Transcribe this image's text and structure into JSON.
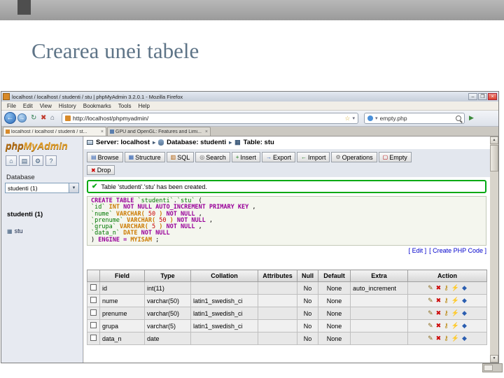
{
  "slide": {
    "title": "Crearea unei tabele"
  },
  "browser": {
    "window_title": "localhost / localhost / studenti / stu | phpMyAdmin 3.2.0.1 - Mozilla Firefox",
    "menu": [
      "File",
      "Edit",
      "View",
      "History",
      "Bookmarks",
      "Tools",
      "Help"
    ],
    "url": "http://localhost/phpmyadmin/",
    "search_value": "empty.php",
    "window_buttons": {
      "minimize": "–",
      "maximize": "❒",
      "close": "×"
    },
    "tabs": [
      {
        "label": "localhost / localhost / studenti / st...",
        "favicon_color": "#d88a2a"
      },
      {
        "label": "GPU and OpenGL: Features and Limi...",
        "favicon_color": "#5b7fae"
      }
    ]
  },
  "pma": {
    "logo_php": "php",
    "logo_myadmin": "MyAdmin",
    "breadcrumb": {
      "server": "Server: localhost",
      "database": "Database: studenti",
      "table": "Table: stu",
      "separator": "▸"
    },
    "tabs": [
      {
        "label": "Browse",
        "glyph": "▤",
        "color": "#2a5db0"
      },
      {
        "label": "Structure",
        "glyph": "▦",
        "color": "#2a5db0"
      },
      {
        "label": "SQL",
        "glyph": "▥",
        "color": "#b05a00"
      },
      {
        "label": "Search",
        "glyph": "◎",
        "color": "#666666"
      },
      {
        "label": "Insert",
        "glyph": "+",
        "color": "#1a7a1a"
      },
      {
        "label": "Export",
        "glyph": "→",
        "color": "#2a5db0"
      },
      {
        "label": "Import",
        "glyph": "←",
        "color": "#1a7a1a"
      },
      {
        "label": "Operations",
        "glyph": "⚙",
        "color": "#666666"
      },
      {
        "label": "Empty",
        "glyph": "▢",
        "color": "#b00000"
      }
    ],
    "drop_tab": {
      "label": "Drop",
      "glyph": "✖"
    },
    "sidebar": {
      "database_label": "Database",
      "database_select": "studenti (1)",
      "database_link": "studenti (1)",
      "table_item": "stu"
    },
    "message": "Table 'studenti'.'stu' has been created.",
    "sql_lines": [
      [
        {
          "c": "kw",
          "t": "CREATE TABLE "
        },
        {
          "c": "id",
          "t": "`studenti`"
        },
        {
          "c": "pl",
          "t": "."
        },
        {
          "c": "id",
          "t": "`stu`"
        },
        {
          "c": "pl",
          "t": " ("
        }
      ],
      [
        {
          "c": "id",
          "t": "`id`"
        },
        {
          "c": "ty",
          "t": " INT"
        },
        {
          "c": "kw",
          "t": " NOT NULL AUTO_INCREMENT PRIMARY KEY"
        },
        {
          "c": "pl",
          "t": " ,"
        }
      ],
      [
        {
          "c": "id",
          "t": "`nume`"
        },
        {
          "c": "ty",
          "t": " VARCHAR("
        },
        {
          "c": "nu",
          "t": " 50 "
        },
        {
          "c": "ty",
          "t": ")"
        },
        {
          "c": "kw",
          "t": " NOT NULL"
        },
        {
          "c": "pl",
          "t": " ,"
        }
      ],
      [
        {
          "c": "id",
          "t": "`prenume`"
        },
        {
          "c": "ty",
          "t": " VARCHAR("
        },
        {
          "c": "nu",
          "t": " 50 "
        },
        {
          "c": "ty",
          "t": ")"
        },
        {
          "c": "kw",
          "t": " NOT NULL"
        },
        {
          "c": "pl",
          "t": " ,"
        }
      ],
      [
        {
          "c": "id",
          "t": "`grupa`"
        },
        {
          "c": "ty",
          "t": " VARCHAR("
        },
        {
          "c": "nu",
          "t": " 5 "
        },
        {
          "c": "ty",
          "t": ")"
        },
        {
          "c": "kw",
          "t": " NOT NULL"
        },
        {
          "c": "pl",
          "t": " ,"
        }
      ],
      [
        {
          "c": "id",
          "t": "`data_n`"
        },
        {
          "c": "ty",
          "t": " DATE"
        },
        {
          "c": "kw",
          "t": " NOT NULL"
        }
      ],
      [
        {
          "c": "pl",
          "t": ") "
        },
        {
          "c": "kw",
          "t": "ENGINE = "
        },
        {
          "c": "ty",
          "t": "MYISAM"
        },
        {
          "c": "pl",
          "t": " ;"
        }
      ]
    ],
    "result_links": [
      "[ Edit ]",
      "[ Create PHP Code ]"
    ],
    "structure_table": {
      "columns": [
        "",
        "Field",
        "Type",
        "Collation",
        "Attributes",
        "Null",
        "Default",
        "Extra",
        "Action"
      ],
      "rows": [
        {
          "field": "id",
          "type": "int(11)",
          "collation": "",
          "attributes": "",
          "null": "No",
          "default": "None",
          "extra": "auto_increment"
        },
        {
          "field": "nume",
          "type": "varchar(50)",
          "collation": "latin1_swedish_ci",
          "attributes": "",
          "null": "No",
          "default": "None",
          "extra": ""
        },
        {
          "field": "prenume",
          "type": "varchar(50)",
          "collation": "latin1_swedish_ci",
          "attributes": "",
          "null": "No",
          "default": "None",
          "extra": ""
        },
        {
          "field": "grupa",
          "type": "varchar(5)",
          "collation": "latin1_swedish_ci",
          "attributes": "",
          "null": "No",
          "default": "None",
          "extra": ""
        },
        {
          "field": "data_n",
          "type": "date",
          "collation": "",
          "attributes": "",
          "null": "No",
          "default": "None",
          "extra": ""
        }
      ],
      "row_actions": [
        {
          "name": "change-icon",
          "glyph": "✎",
          "color": "#8a6d1f"
        },
        {
          "name": "drop-icon",
          "glyph": "✖",
          "color": "#cc0000"
        },
        {
          "name": "primary-icon",
          "glyph": "⚷",
          "color": "#b8860b"
        },
        {
          "name": "index-icon",
          "glyph": "⚡",
          "color": "#777777"
        },
        {
          "name": "unique-icon",
          "glyph": "◆",
          "color": "#2a5db0"
        }
      ]
    }
  }
}
